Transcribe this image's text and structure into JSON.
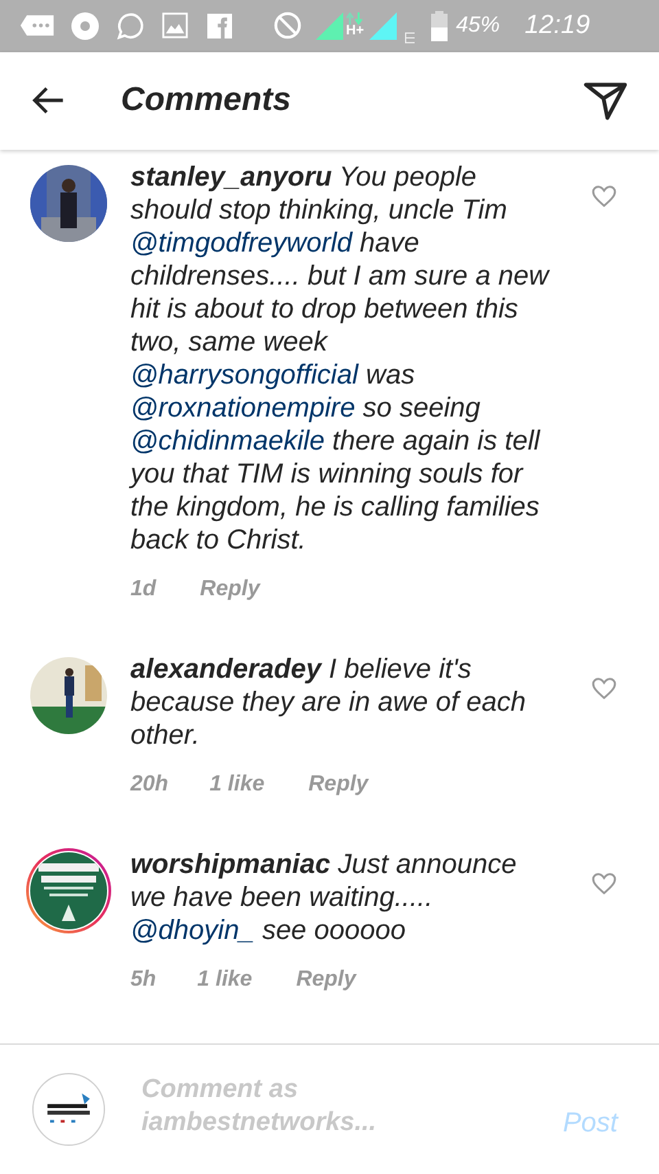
{
  "status_bar": {
    "network": "H+",
    "battery": "45%",
    "time": "12:19"
  },
  "header": {
    "title": "Comments"
  },
  "comments": [
    {
      "username": "stanley_anyoru",
      "story_ring": false,
      "liked": false,
      "body": [
        {
          "kind": "text",
          "text": "You people should stop thinking, uncle Tim"
        },
        {
          "kind": "mention",
          "text": "@timgodfreyworld"
        },
        {
          "kind": "text",
          "text": "have childrenses.... but I am sure a new hit is about to drop between this two, same week"
        },
        {
          "kind": "mention",
          "text": "@harrysongofficial"
        },
        {
          "kind": "text",
          "text": "was"
        },
        {
          "kind": "mention",
          "text": "@roxnationempire"
        },
        {
          "kind": "text",
          "text": "so seeing"
        },
        {
          "kind": "mention",
          "text": "@chidinmaekile"
        },
        {
          "kind": "text",
          "text": "there again is tell you that TIM is winning souls for the kingdom, he is calling families back to Christ."
        }
      ],
      "time": "1d",
      "reply": "Reply"
    },
    {
      "username": "alexanderadey",
      "story_ring": false,
      "liked": false,
      "body": [
        {
          "kind": "text",
          "text": "I believe it's because they are in awe of each other."
        }
      ],
      "time": "20h",
      "likes": "1 like",
      "reply": "Reply"
    },
    {
      "username": "worshipmaniac",
      "story_ring": true,
      "liked": false,
      "body": [
        {
          "kind": "text",
          "text": "Just announce we have been waiting....."
        },
        {
          "kind": "mention",
          "text": "@dhoyin_"
        },
        {
          "kind": "text",
          "text": "see oooooo"
        }
      ],
      "time": "5h",
      "likes": "1 like",
      "reply": "Reply"
    }
  ],
  "composer": {
    "placeholder": "Comment as iambestnetworks...",
    "post": {
      "label": "Post",
      "disabled": true
    }
  }
}
